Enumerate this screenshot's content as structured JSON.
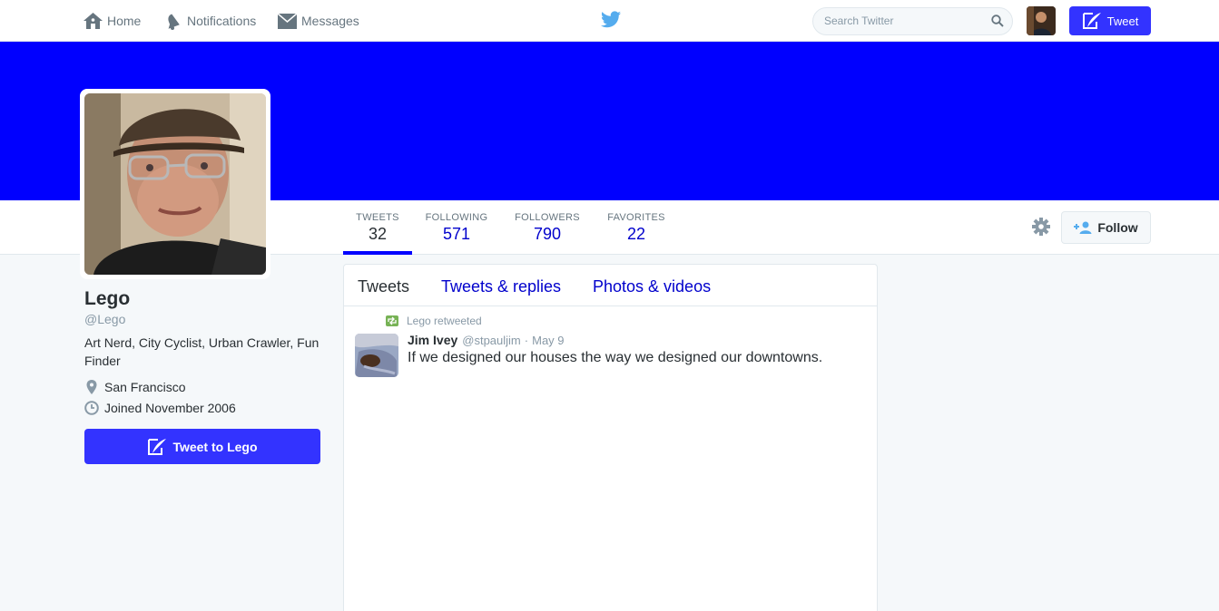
{
  "nav": {
    "home_label": "Home",
    "notifications_label": "Notifications",
    "messages_label": "Messages",
    "search_placeholder": "Search Twitter",
    "tweet_button_label": "Tweet"
  },
  "profile": {
    "banner_color": "#0000ff",
    "name": "Lego",
    "handle": "@Lego",
    "bio": "Art Nerd, City Cyclist, Urban Crawler, Fun Finder",
    "location": "San Francisco",
    "joined": "Joined November 2006",
    "tweet_to_label": "Tweet to Lego"
  },
  "stats": {
    "tweets_label": "TWEETS",
    "tweets_value": "32",
    "following_label": "FOLLOWING",
    "following_value": "571",
    "followers_label": "FOLLOWERS",
    "followers_value": "790",
    "favorites_label": "FAVORITES",
    "favorites_value": "22"
  },
  "actions": {
    "follow_label": "Follow"
  },
  "timeline": {
    "tabs": [
      "Tweets",
      "Tweets & replies",
      "Photos & videos"
    ],
    "active_tab": "Tweets",
    "items": [
      {
        "retweet_context": "Lego retweeted",
        "author_name": "Jim Ivey",
        "author_handle": "@stpauljim",
        "separator": "·",
        "time": "May 9",
        "text": "If we designed our houses the way we designed our downtowns."
      }
    ]
  },
  "colors": {
    "accent": "#3333ff",
    "link": "#0000cc",
    "muted": "#8899a6",
    "retweet_green": "#77b255"
  },
  "icons": [
    "home-icon",
    "bell-icon",
    "envelope-icon",
    "twitter-bird-icon",
    "search-icon",
    "gear-icon",
    "add-user-icon",
    "quill-icon",
    "map-pin-icon",
    "clock-icon",
    "retweet-icon"
  ]
}
